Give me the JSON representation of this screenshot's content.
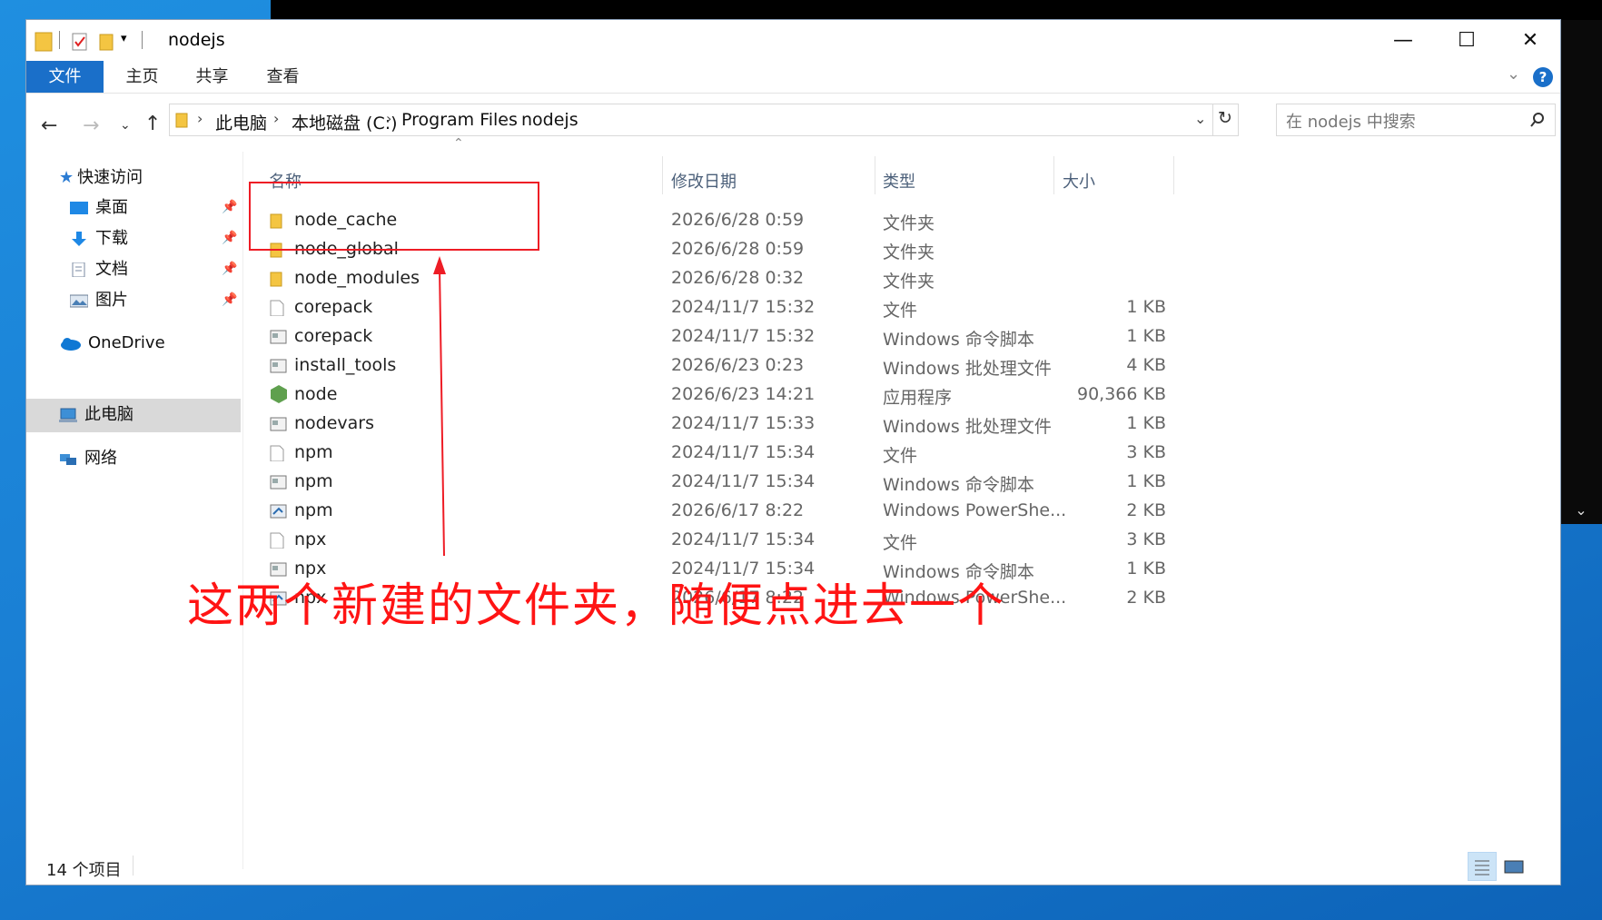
{
  "window": {
    "title": "nodejs",
    "controls": {
      "minimize": "—",
      "maximize": "☐",
      "close": "✕"
    }
  },
  "ribbon": {
    "tabs": [
      {
        "label": "文件",
        "active": true
      },
      {
        "label": "主页"
      },
      {
        "label": "共享"
      },
      {
        "label": "查看"
      }
    ],
    "help": "?"
  },
  "address": {
    "crumbs": [
      "此电脑",
      "本地磁盘 (C:)",
      "Program Files",
      "nodejs"
    ],
    "search_placeholder": "在 nodejs 中搜索"
  },
  "nav": {
    "quick_access": "快速访问",
    "items": [
      {
        "label": "桌面",
        "icon": "desktop-icon",
        "pinned": true
      },
      {
        "label": "下载",
        "icon": "download-icon",
        "pinned": true
      },
      {
        "label": "文档",
        "icon": "documents-icon",
        "pinned": true
      },
      {
        "label": "图片",
        "icon": "pictures-icon",
        "pinned": true
      }
    ],
    "onedrive": "OneDrive",
    "this_pc": "此电脑",
    "network": "网络"
  },
  "columns": {
    "name": "名称",
    "date": "修改日期",
    "type": "类型",
    "size": "大小"
  },
  "files": [
    {
      "name": "node_cache",
      "date": "2026/6/28 0:59",
      "type": "文件夹",
      "size": "",
      "icon": "folder-icon"
    },
    {
      "name": "node_global",
      "date": "2026/6/28 0:59",
      "type": "文件夹",
      "size": "",
      "icon": "folder-icon"
    },
    {
      "name": "node_modules",
      "date": "2026/6/28 0:32",
      "type": "文件夹",
      "size": "",
      "icon": "folder-icon"
    },
    {
      "name": "corepack",
      "date": "2024/11/7 15:32",
      "type": "文件",
      "size": "1 KB",
      "icon": "file-icon"
    },
    {
      "name": "corepack",
      "date": "2024/11/7 15:32",
      "type": "Windows 命令脚本",
      "size": "1 KB",
      "icon": "script-icon"
    },
    {
      "name": "install_tools",
      "date": "2026/6/23 0:23",
      "type": "Windows 批处理文件",
      "size": "4 KB",
      "icon": "script-icon"
    },
    {
      "name": "node",
      "date": "2026/6/23 14:21",
      "type": "应用程序",
      "size": "90,366 KB",
      "icon": "node-app-icon"
    },
    {
      "name": "nodevars",
      "date": "2024/11/7 15:33",
      "type": "Windows 批处理文件",
      "size": "1 KB",
      "icon": "script-icon"
    },
    {
      "name": "npm",
      "date": "2024/11/7 15:34",
      "type": "文件",
      "size": "3 KB",
      "icon": "file-icon"
    },
    {
      "name": "npm",
      "date": "2024/11/7 15:34",
      "type": "Windows 命令脚本",
      "size": "1 KB",
      "icon": "script-icon"
    },
    {
      "name": "npm",
      "date": "2026/6/17 8:22",
      "type": "Windows PowerShe...",
      "size": "2 KB",
      "icon": "powershell-icon"
    },
    {
      "name": "npx",
      "date": "2024/11/7 15:34",
      "type": "文件",
      "size": "3 KB",
      "icon": "file-icon"
    },
    {
      "name": "npx",
      "date": "2024/11/7 15:34",
      "type": "Windows 命令脚本",
      "size": "1 KB",
      "icon": "script-icon"
    },
    {
      "name": "npx",
      "date": "2026/6/17 8:22",
      "type": "Windows PowerShe...",
      "size": "2 KB",
      "icon": "powershell-icon"
    }
  ],
  "status": {
    "count": "14 个项目"
  },
  "annotation": {
    "text": "这两个新建的文件夹，随便点进去一个",
    "color": "#ff1414"
  },
  "colors": {
    "accent": "#1a6fc9",
    "folder": "#f4c542",
    "node": "#5fa04e"
  }
}
